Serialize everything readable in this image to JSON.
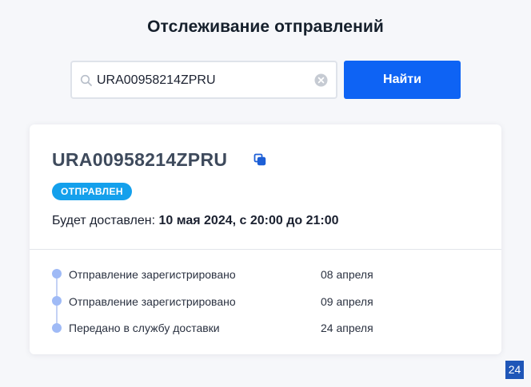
{
  "page": {
    "title": "Отслеживание отправлений"
  },
  "search": {
    "value": "URA00958214ZPRU",
    "icon": "search-icon",
    "clear_icon": "clear-icon"
  },
  "find_button": {
    "label": "Найти"
  },
  "shipment": {
    "tracking_number": "URA00958214ZPRU",
    "copy_icon": "copy-icon",
    "status": "ОТПРАВЛЕН",
    "delivery_label": "Будет доставлен:",
    "delivery_value": "10 мая 2024, с 20:00 до 21:00",
    "events": [
      {
        "label": "Отправление зарегистрировано",
        "date": "08 апреля"
      },
      {
        "label": "Отправление зарегистрировано",
        "date": "09 апреля"
      },
      {
        "label": "Передано в службу доставки",
        "date": "24 апреля"
      }
    ]
  },
  "corner_badge": {
    "text": "24"
  },
  "colors": {
    "background": "#f6f7fa",
    "accent": "#0e63f4",
    "status_badge": "#14a0ec",
    "timeline": "#9fbaf6"
  }
}
